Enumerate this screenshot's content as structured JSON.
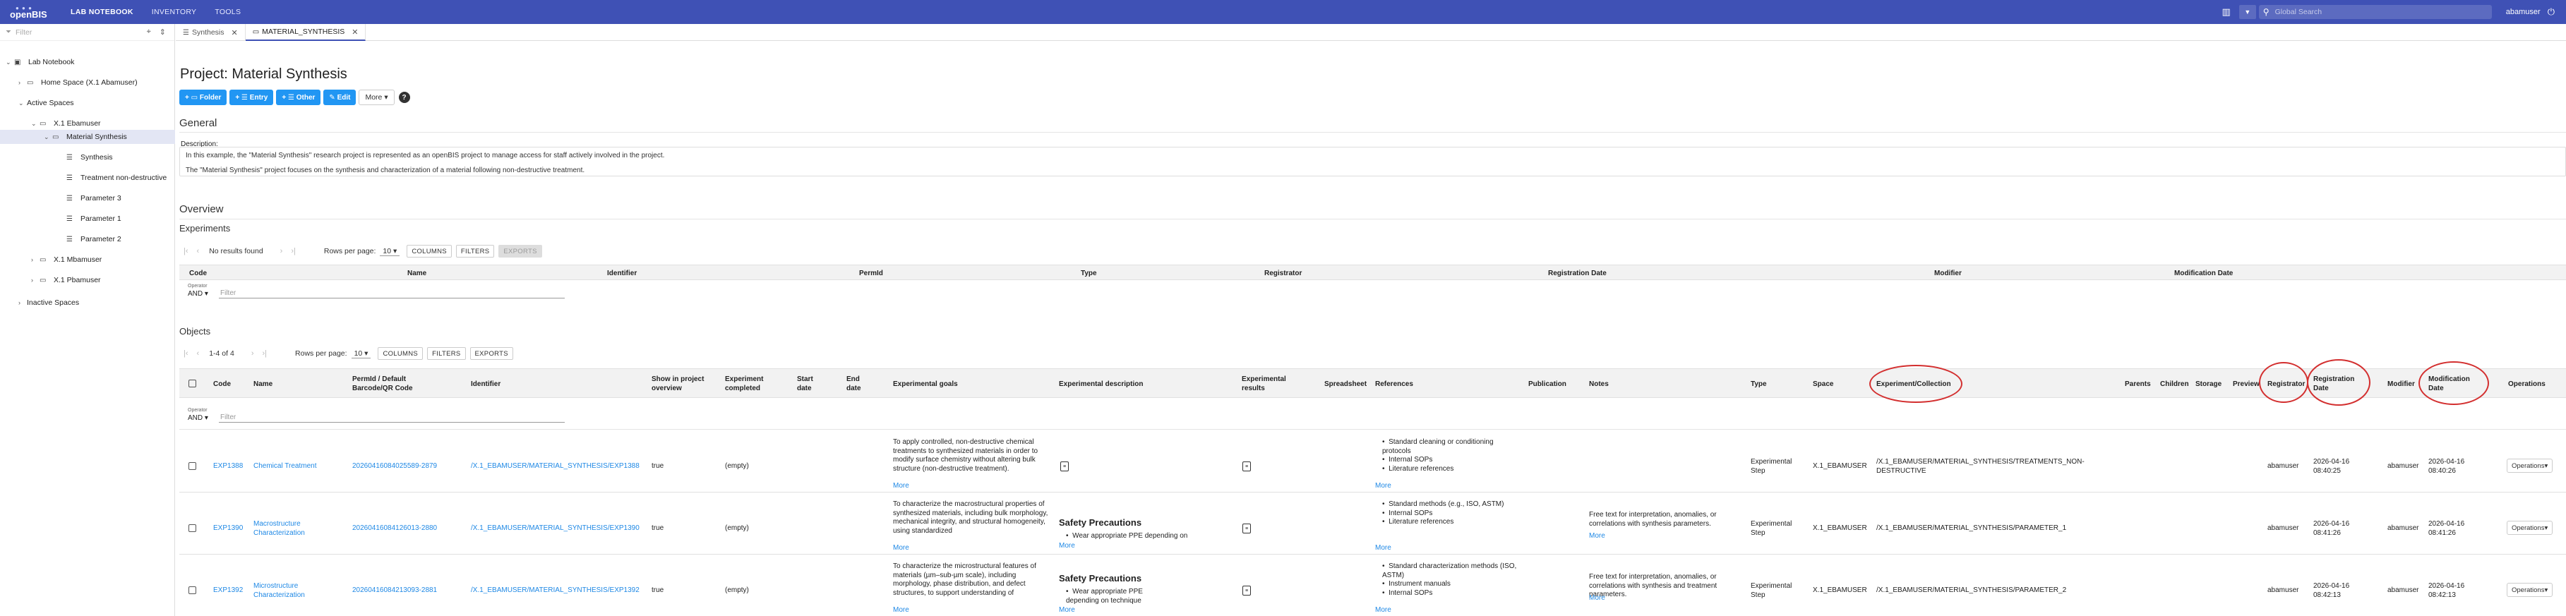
{
  "topbar": {
    "logo": "openBIS",
    "nav": [
      "LAB NOTEBOOK",
      "INVENTORY",
      "TOOLS"
    ],
    "search_placeholder": "Global Search",
    "user": "abamuser"
  },
  "sidebar": {
    "filter_placeholder": "Filter",
    "items": [
      {
        "label": "Lab Notebook",
        "chev": "v",
        "icon": "notebook-icon"
      },
      {
        "label": "Home Space (X.1 Abamuser)",
        "chev": ">",
        "icon": "folder-icon"
      },
      {
        "label": "Active Spaces",
        "chev": "v",
        "icon": ""
      },
      {
        "label": "X.1 Ebamuser",
        "chev": "v",
        "icon": "folder-icon"
      },
      {
        "label": "Material Synthesis",
        "chev": "v",
        "icon": "folder-icon"
      },
      {
        "label": "Synthesis",
        "chev": "",
        "icon": "experiment-icon"
      },
      {
        "label": "Treatment non-destructive",
        "chev": "",
        "icon": "experiment-icon"
      },
      {
        "label": "Parameter 3",
        "chev": "",
        "icon": "experiment-icon"
      },
      {
        "label": "Parameter 1",
        "chev": "",
        "icon": "experiment-icon"
      },
      {
        "label": "Parameter 2",
        "chev": "",
        "icon": "experiment-icon"
      },
      {
        "label": "X.1 Mbamuser",
        "chev": ">",
        "icon": "folder-icon"
      },
      {
        "label": "X.1 Pbamuser",
        "chev": ">",
        "icon": "folder-icon"
      },
      {
        "label": "Inactive Spaces",
        "chev": ">",
        "icon": ""
      }
    ]
  },
  "tabs": [
    {
      "label": "Synthesis"
    },
    {
      "label": "MATERIAL_SYNTHESIS"
    }
  ],
  "page": {
    "title": "Project: Material Synthesis",
    "buttons": [
      "Folder",
      "Entry",
      "Other",
      "Edit"
    ],
    "more_label": "More",
    "general_h": "General",
    "description_label": "Description:",
    "description_lines": [
      "In this example, the \"Material Synthesis\" research project is represented as an openBIS project to manage access for staff actively involved in the project.",
      "The \"Material Synthesis\" project focuses on the synthesis and characterization of a material following non-destructive treatment."
    ],
    "overview_h": "Overview"
  },
  "experiments": {
    "heading": "Experiments",
    "no_results": "No results found",
    "rows_per_page_label": "Rows per page:",
    "rows_per_page": "10",
    "toolbar": [
      "COLUMNS",
      "FILTERS",
      "EXPORTS"
    ],
    "columns": [
      "Code",
      "Name",
      "Identifier",
      "PermId",
      "Type",
      "Registrator",
      "Registration Date",
      "Modifier",
      "Modification Date"
    ],
    "operator_label": "Operator",
    "operator_value": "AND",
    "filter_placeholder": "Filter"
  },
  "objects": {
    "heading": "Objects",
    "range": "1-4 of 4",
    "rows_per_page_label": "Rows per page:",
    "rows_per_page": "10",
    "toolbar": [
      "COLUMNS",
      "FILTERS",
      "EXPORTS"
    ],
    "columns": {
      "code": "Code",
      "name": "Name",
      "permid": "PermId / Default Barcode/QR Code",
      "identifier": "Identifier",
      "show": "Show in project overview",
      "completed": "Experiment completed",
      "start": "Start date",
      "end": "End date",
      "goals": "Experimental goals",
      "description": "Experimental description",
      "results": "Experimental results",
      "spreadsheet": "Spreadsheet",
      "references": "References",
      "publication": "Publication",
      "notes": "Notes",
      "type": "Type",
      "space": "Space",
      "collection": "Experiment/Collection",
      "parents": "Parents",
      "children": "Children",
      "storage": "Storage",
      "preview": "Preview",
      "registrator": "Registrator",
      "regdate": "Registration Date",
      "modifier": "Modifier",
      "moddate": "Modification Date",
      "operations": "Operations"
    },
    "operator_label": "Operator",
    "operator_value": "AND",
    "filter_placeholder": "Filter",
    "more": "More",
    "operations_label": "Operations",
    "rows": [
      {
        "code": "EXP1388",
        "name": "Chemical Treatment",
        "permid": "20260416084025589-2879",
        "identifier": "/X.1_EBAMUSER/MATERIAL_SYNTHESIS/EXP1388",
        "show": "true",
        "completed": "(empty)",
        "goals": "To apply controlled, non-destructive chemical treatments to synthesized materials in order to modify surface chemistry without altering bulk structure (non-destructive treatment).",
        "desc_title": "",
        "desc_bullet": "",
        "refs": [
          "Standard cleaning or conditioning protocols",
          "Internal SOPs",
          "Literature references"
        ],
        "notes": "",
        "type": "Experimental Step",
        "space": "X.1_EBAMUSER",
        "collection": "/X.1_EBAMUSER/MATERIAL_SYNTHESIS/TREATMENTS_NON-DESTRUCTIVE",
        "registrator": "abamuser",
        "regdate": "2026-04-16 08:40:25",
        "modifier": "abamuser",
        "moddate": "2026-04-16 08:40:26"
      },
      {
        "code": "EXP1390",
        "name": "Macrostructure Characterization",
        "permid": "20260416084126013-2880",
        "identifier": "/X.1_EBAMUSER/MATERIAL_SYNTHESIS/EXP1390",
        "show": "true",
        "completed": "(empty)",
        "goals": "To characterize the macrostructural properties of synthesized materials, including bulk morphology, mechanical integrity, and structural homogeneity, using standardized",
        "desc_title": "Safety Precautions",
        "desc_bullet": "Wear appropriate PPE depending on",
        "refs": [
          "Standard methods (e.g., ISO, ASTM)",
          "Internal SOPs",
          "Literature references"
        ],
        "notes": "Free text for interpretation, anomalies, or correlations with synthesis parameters.",
        "type": "Experimental Step",
        "space": "X.1_EBAMUSER",
        "collection": "/X.1_EBAMUSER/MATERIAL_SYNTHESIS/PARAMETER_1",
        "registrator": "abamuser",
        "regdate": "2026-04-16 08:41:26",
        "modifier": "abamuser",
        "moddate": "2026-04-16 08:41:26"
      },
      {
        "code": "EXP1392",
        "name": "Microstructure Characterization",
        "permid": "20260416084213093-2881",
        "identifier": "/X.1_EBAMUSER/MATERIAL_SYNTHESIS/EXP1392",
        "show": "true",
        "completed": "(empty)",
        "goals": "To characterize the microstructural features of materials (µm–sub-µm scale), including morphology, phase distribution, and defect structures, to support understanding of",
        "desc_title": "Safety Precautions",
        "desc_bullet": "Wear appropriate PPE depending on technique",
        "refs": [
          "Standard characterization methods (ISO, ASTM)",
          "Instrument manuals",
          "Internal SOPs"
        ],
        "notes": "Free text for interpretation, anomalies, or correlations with synthesis and treatment parameters.",
        "type": "Experimental Step",
        "space": "X.1_EBAMUSER",
        "collection": "/X.1_EBAMUSER/MATERIAL_SYNTHESIS/PARAMETER_2",
        "registrator": "abamuser",
        "regdate": "2026-04-16 08:42:13",
        "modifier": "abamuser",
        "moddate": "2026-04-16 08:42:13"
      }
    ]
  },
  "colors": {
    "topbar": "#3f51b5",
    "accent": "#2196f3",
    "link": "#1e88e5",
    "annotation": "#d32f2f"
  }
}
